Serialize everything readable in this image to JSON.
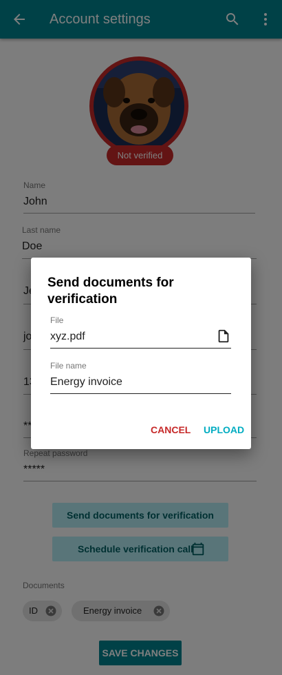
{
  "appbar": {
    "title": "Account settings",
    "back_icon": "arrow-back-icon",
    "search_icon": "search-icon",
    "more_icon": "more-vert-icon"
  },
  "profile": {
    "status_badge": "Not verified",
    "status_color": "#c62828"
  },
  "form": {
    "name_label": "Name",
    "name_value": "John",
    "lastname_label": "Last name",
    "lastname_value": "Doe",
    "field3_value": "Je",
    "field4_value": "jo",
    "field5_value": "13",
    "field6_value": "**",
    "repeat_password_label": "Repeat password",
    "repeat_password_value": "*****"
  },
  "actions": {
    "send_documents": "Send documents for verification",
    "schedule_call": "Schedule verification call",
    "save_changes": "SAVE CHANGES"
  },
  "documents": {
    "label": "Documents",
    "chips": [
      "ID",
      "Energy invoice"
    ]
  },
  "dialog": {
    "title": "Send documents for verification",
    "file_label": "File",
    "file_value": "xyz.pdf",
    "file_icon": "file-icon",
    "filename_label": "File name",
    "filename_value": "Energy invoice",
    "cancel_label": "CANCEL",
    "upload_label": "UPLOAD"
  },
  "colors": {
    "primary": "#00838f",
    "accent": "#00acc1",
    "error": "#c62828"
  }
}
